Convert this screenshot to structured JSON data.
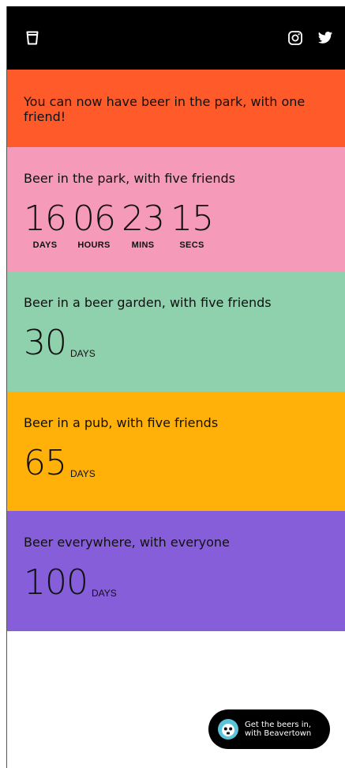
{
  "colors": {
    "header_bg": "#000000",
    "banner_bg": "#ff5a2a",
    "park_bg": "#f59ab9",
    "garden_bg": "#8fd1ad",
    "pub_bg": "#ffb10a",
    "everywhere_bg": "#875ed9"
  },
  "header": {
    "logo_icon": "pint-glass-icon",
    "social_icons": [
      "instagram-icon",
      "twitter-icon"
    ]
  },
  "banner": {
    "text": "You can now have beer in the park, with one friend!"
  },
  "park": {
    "title": "Beer in the park, with five friends",
    "countdown": [
      {
        "value": "16",
        "label": "DAYS"
      },
      {
        "value": "06",
        "label": "HOURS"
      },
      {
        "value": "23",
        "label": "MINS"
      },
      {
        "value": "15",
        "label": "SECS"
      }
    ]
  },
  "garden": {
    "title": "Beer in a beer garden, with five friends",
    "days": "30",
    "unit": "DAYS"
  },
  "pub": {
    "title": "Beer in a pub, with five friends",
    "days": "65",
    "unit": "DAYS"
  },
  "everywhere": {
    "title": "Beer everywhere, with everyone",
    "days": "100",
    "unit": "DAYS"
  },
  "cta": {
    "line1": "Get the beers in,",
    "line2": "with Beavertown",
    "icon": "beaver-logo-icon"
  }
}
